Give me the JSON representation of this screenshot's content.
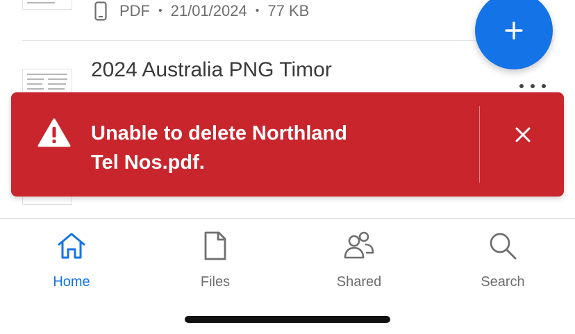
{
  "files": [
    {
      "type_label": "PDF",
      "date": "21/01/2024",
      "size": "77 KB"
    },
    {
      "title": "2024 Australia PNG Timor"
    }
  ],
  "toast": {
    "message_line1": "Unable to delete Northland",
    "message_line2": "Tel Nos.pdf."
  },
  "nav": {
    "items": [
      {
        "label": "Home",
        "active": true
      },
      {
        "label": "Files"
      },
      {
        "label": "Shared"
      },
      {
        "label": "Search"
      }
    ]
  },
  "colors": {
    "accent": "#1473e6",
    "error": "#c9252d",
    "muted_text": "#6e6e6e"
  }
}
